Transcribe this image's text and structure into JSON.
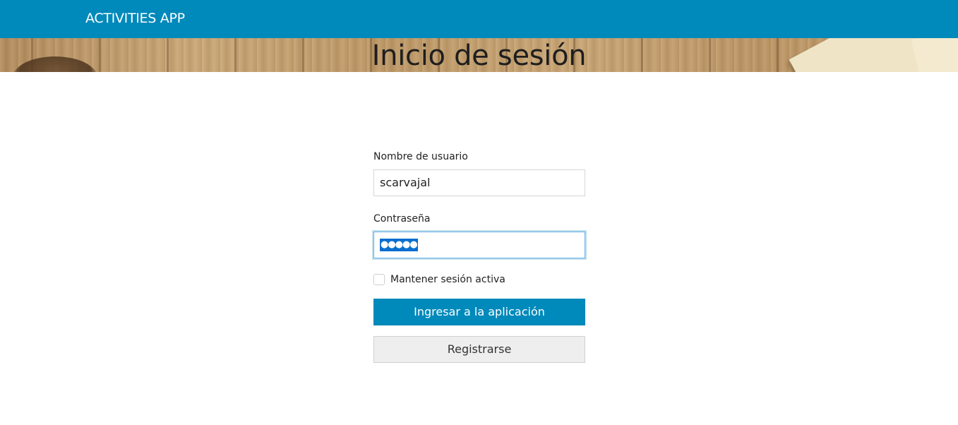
{
  "navbar": {
    "brand": "ACTIVITIES APP",
    "color": "#0089bb"
  },
  "banner": {
    "title": "Inicio de sesión",
    "background": "wood-texture"
  },
  "login_form": {
    "username_label": "Nombre de usuario",
    "username_value": "scarvajal",
    "password_label": "Contraseña",
    "password_value": "●●●●●",
    "remember_label": "Mantener sesión activa",
    "remember_checked": false,
    "submit_label": "Ingresar a la aplicación",
    "register_label": "Registrarse"
  }
}
